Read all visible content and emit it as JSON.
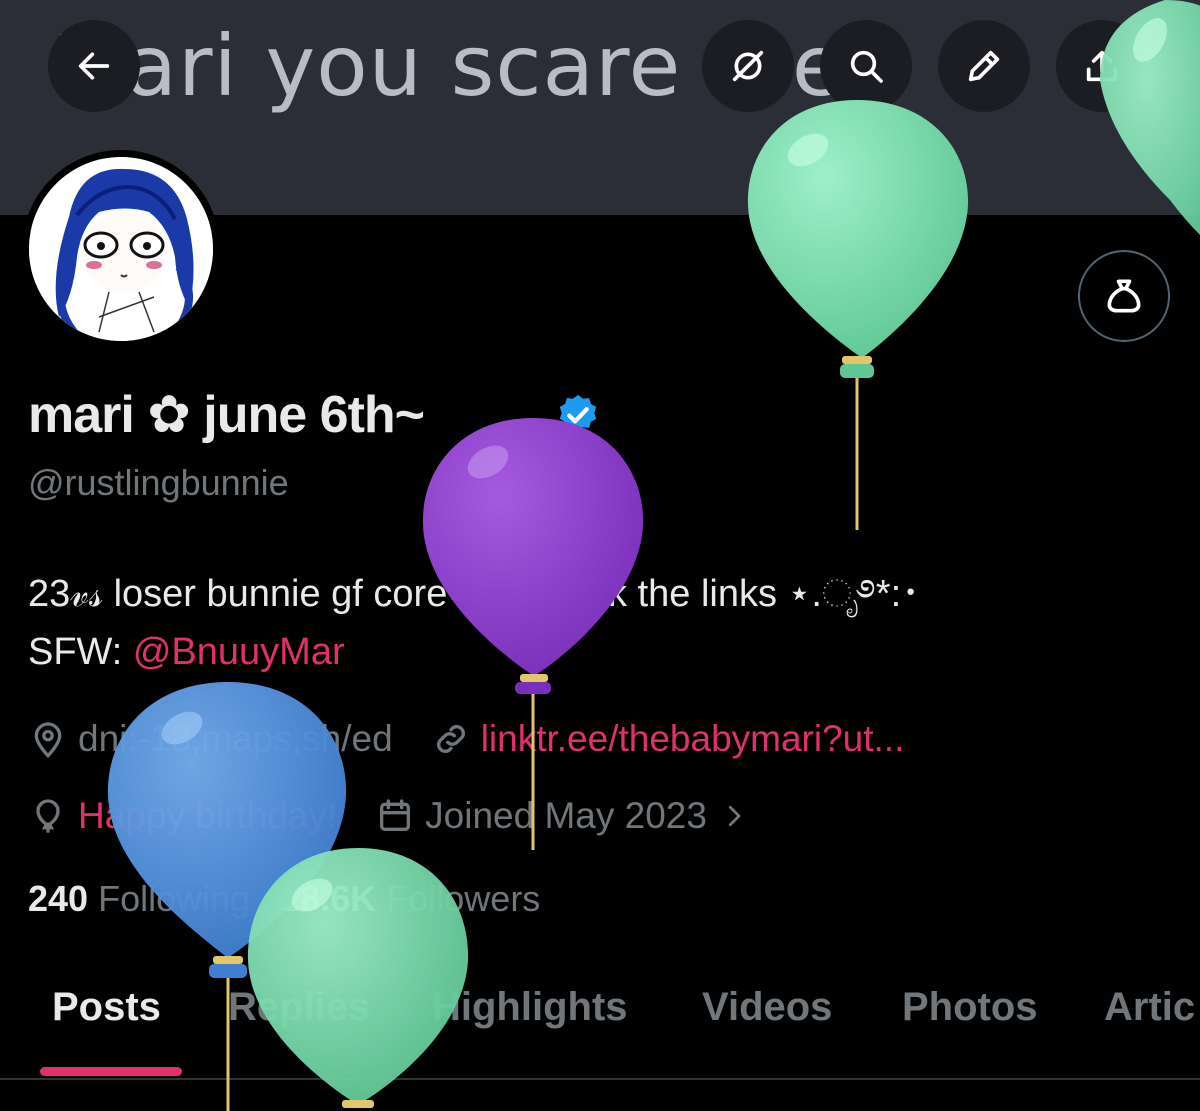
{
  "banner": {
    "text": "Mari you scare me"
  },
  "topbar": {
    "back_icon": "arrow-left-icon",
    "buttons": [
      "mute-icon",
      "search-icon",
      "edit-pencil-icon",
      "share-upload-icon"
    ]
  },
  "profile": {
    "display_name": "mari ✿ june 6th~",
    "handle": "@rustlingbunnie",
    "bio_line1_a": "23𝓋𝓈 loser bunnie gf core",
    "bio_line1_heart": "≕❤",
    "bio_line1_b": " check the links ⋆.ೃ࿔*:･",
    "bio_line2_prefix": "SFW: ",
    "bio_line2_mention": "@BnuuyMar",
    "location": "dni:-18,maps,sh/ed",
    "website": "linktr.ee/thebabymari?ut...",
    "birthday": "Happy birthday!",
    "joined": "Joined May 2023",
    "following_count": "240",
    "following_label": "Following",
    "followers_count": "18.6K",
    "followers_label": "Followers"
  },
  "tabs": [
    "Posts",
    "Replies",
    "Highlights",
    "Videos",
    "Photos",
    "Artic"
  ],
  "active_tab": "Posts",
  "colors": {
    "accent": "#e0306f",
    "verified": "#1d9bf0",
    "balloon_green": "#6fd3a3",
    "balloon_purple": "#8a3cc8",
    "balloon_blue": "#4f8fdc"
  }
}
